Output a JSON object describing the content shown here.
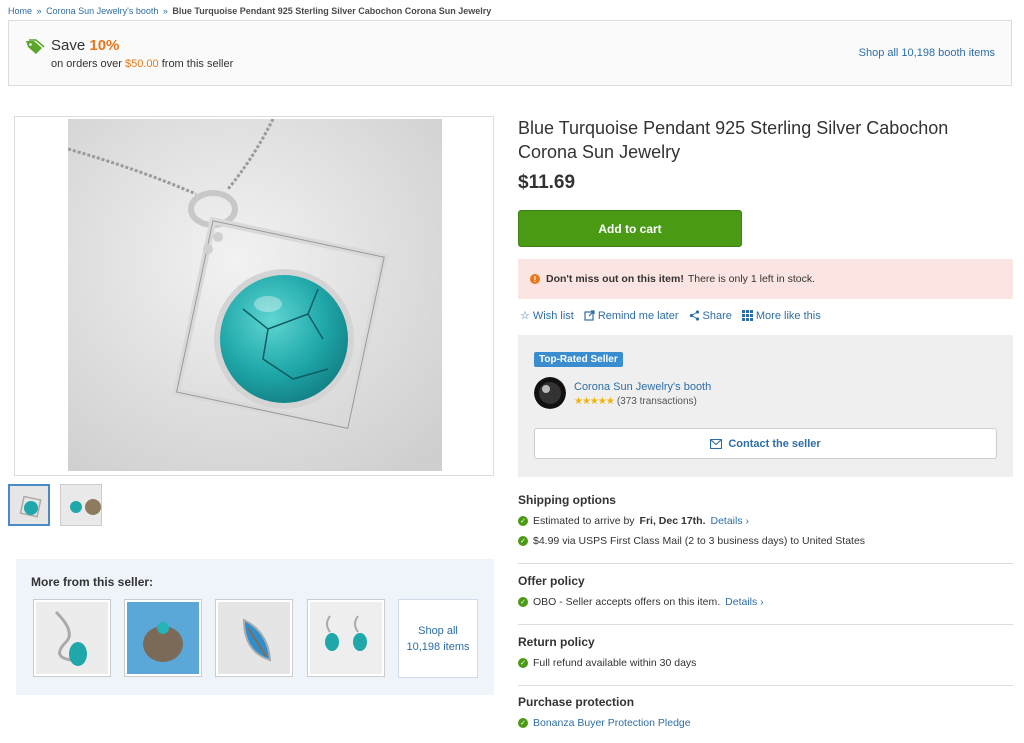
{
  "breadcrumb": {
    "home": "Home",
    "sep": "»",
    "booth": "Corona Sun Jewelry's booth",
    "current": "Blue Turquoise Pendant 925 Sterling Silver Cabochon Corona Sun Jewelry"
  },
  "promo": {
    "save_word": "Save",
    "save_pct": "10%",
    "sub_prefix": "on orders over",
    "sub_amount": "$50.00",
    "sub_suffix": "from this seller",
    "shop_all": "Shop all 10,198 booth items",
    "tag_color": "#5aa52a"
  },
  "product": {
    "title": "Blue Turquoise Pendant 925 Sterling Silver Cabochon Corona Sun Jewelry",
    "price": "$11.69",
    "add_to_cart": "Add to cart"
  },
  "alert": {
    "bold": "Don't miss out on this item!",
    "text": "There is only 1 left in stock.",
    "icon": "!"
  },
  "actions": {
    "wish_list": "Wish list",
    "remind": "Remind me later",
    "share": "Share",
    "more_like": "More like this"
  },
  "seller": {
    "badge": "Top-Rated Seller",
    "name": "Corona Sun Jewelry's booth",
    "stars": "★★★★★",
    "transactions": "(373 transactions)",
    "contact": "Contact the seller"
  },
  "more": {
    "title": "More from this seller:",
    "shop_all": "Shop all 10,198 items"
  },
  "shipping": {
    "title": "Shipping options",
    "estimate_prefix": "Estimated to arrive by",
    "estimate_date": "Fri, Dec 17th.",
    "details": "Details ›",
    "method": "$4.99 via USPS First Class Mail (2 to 3 business days) to United States"
  },
  "offer": {
    "title": "Offer policy",
    "text": "OBO - Seller accepts offers on this item.",
    "details": "Details ›"
  },
  "return": {
    "title": "Return policy",
    "text": "Full refund available within 30 days"
  },
  "protection": {
    "title": "Purchase protection",
    "link": "Bonanza Buyer Protection Pledge"
  }
}
